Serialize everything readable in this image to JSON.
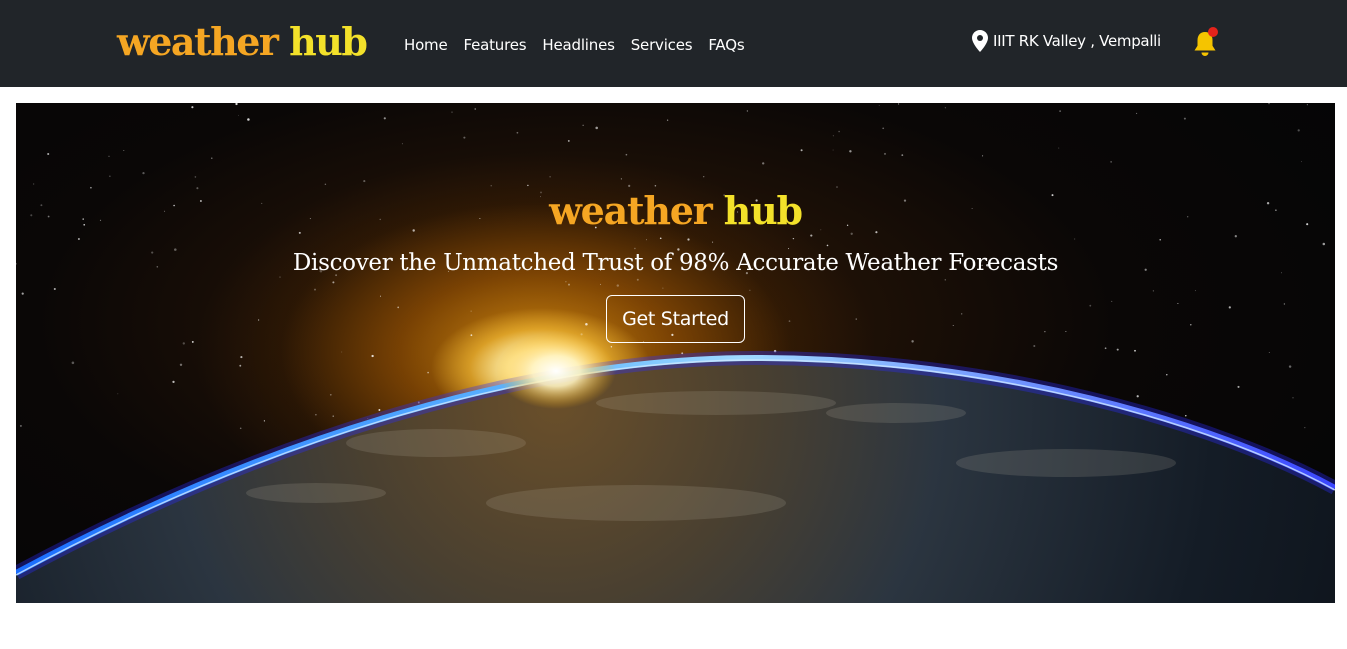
{
  "navbar": {
    "brand": {
      "word1": "weather",
      "word2": "hub"
    },
    "links": [
      "Home",
      "Features",
      "Headlines",
      "Services",
      "FAQs"
    ],
    "location": {
      "icon": "map-pin-icon",
      "text": "IIIT RK Valley , Vempalli"
    },
    "notification": {
      "icon": "bell-icon",
      "has_unread": true
    }
  },
  "hero": {
    "title": {
      "word1": "weather",
      "word2": "hub"
    },
    "subtitle": "Discover the Unmatched Trust of 98% Accurate Weather Forecasts",
    "cta_label": "Get Started",
    "background": "earth-sunrise-from-space"
  },
  "colors": {
    "navbar_bg": "#212529",
    "brand_orange": "#f5a623",
    "brand_yellow": "#f3e12a",
    "bell_yellow": "#f5c400",
    "badge_red": "#e5231b"
  }
}
